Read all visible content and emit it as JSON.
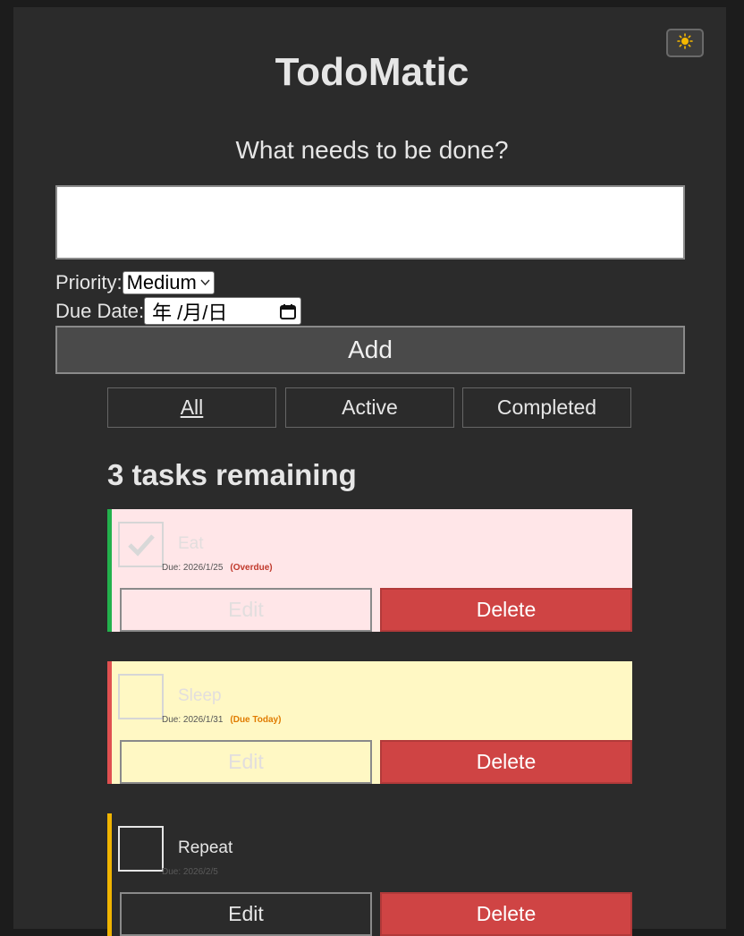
{
  "app": {
    "title": "TodoMatic",
    "theme_icon": "sun-icon"
  },
  "form": {
    "heading": "What needs to be done?",
    "input_value": "",
    "priority_label": "Priority:",
    "priority_value": "Medium",
    "due_label": "Due Date:",
    "due_placeholder": "年 /月/日",
    "add_label": "Add"
  },
  "filters": [
    {
      "label": "All",
      "pressed": true
    },
    {
      "label": "Active",
      "pressed": false
    },
    {
      "label": "Completed",
      "pressed": false
    }
  ],
  "remaining": "3 tasks remaining",
  "todos": [
    {
      "name": "Eat",
      "completed": true,
      "due": "Due: 2026/1/25",
      "status": "(Overdue)",
      "priority_color": "#22b14c",
      "bg": "#ffe6e8",
      "status_color": "#c0392b",
      "edit": "Edit",
      "delete": "Delete"
    },
    {
      "name": "Sleep",
      "completed": false,
      "due": "Due: 2026/1/31",
      "status": "(Due Today)",
      "priority_color": "#e05050",
      "bg": "#fff8c4",
      "status_color": "#e07b00",
      "edit": "Edit",
      "delete": "Delete"
    },
    {
      "name": "Repeat",
      "completed": false,
      "due": "Due: 2026/2/5",
      "status": "",
      "priority_color": "#f0b400",
      "bg": "#2b2b2b",
      "status_color": "#888888",
      "edit": "Edit",
      "delete": "Delete"
    }
  ]
}
